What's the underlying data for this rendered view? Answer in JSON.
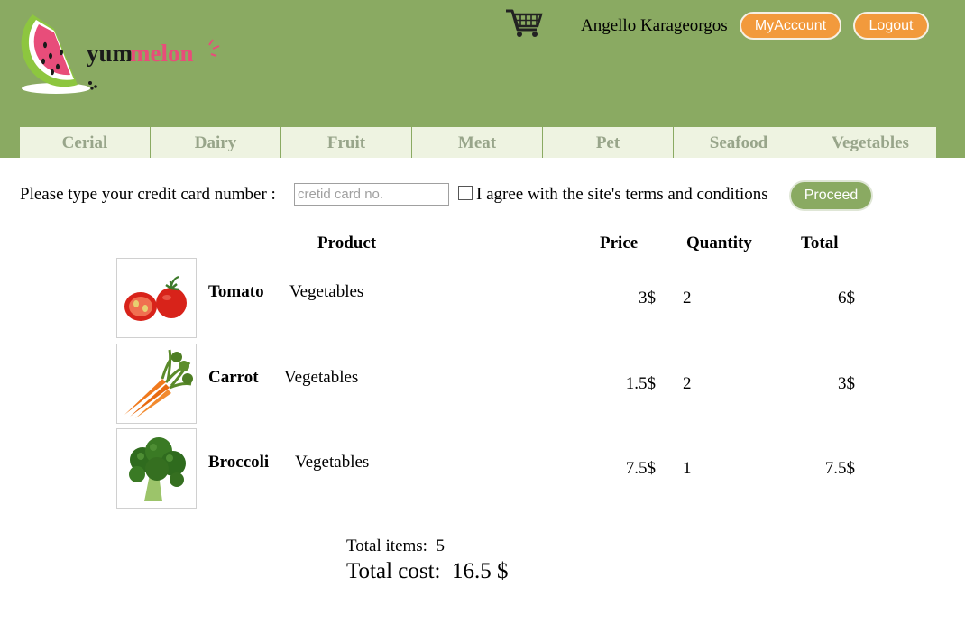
{
  "header": {
    "logo_text_part1": "yum",
    "logo_text_part2": "melon",
    "username": "Angello Karageorgos",
    "myaccount_label": "MyAccount",
    "logout_label": "Logout"
  },
  "categories": [
    "Cerial",
    "Dairy",
    "Fruit",
    "Meat",
    "Pet",
    "Seafood",
    "Vegetables"
  ],
  "payment": {
    "label": "Please type your credit card number :",
    "input_placeholder": "cretid card no.",
    "input_value": "",
    "terms_checked": false,
    "terms_label": "I agree with the site's terms and conditions",
    "proceed_label": "Proceed"
  },
  "table": {
    "headers": {
      "product": "Product",
      "price": "Price",
      "quantity": "Quantity",
      "total": "Total"
    },
    "rows": [
      {
        "name": "Tomato",
        "category": "Vegetables",
        "price": "3$",
        "quantity": "2",
        "total": "6$",
        "image": "tomato-image"
      },
      {
        "name": "Carrot",
        "category": "Vegetables",
        "price": "1.5$",
        "quantity": "2",
        "total": "3$",
        "image": "carrot-image"
      },
      {
        "name": "Broccoli",
        "category": "Vegetables",
        "price": "7.5$",
        "quantity": "1",
        "total": "7.5$",
        "image": "broccoli-image"
      }
    ]
  },
  "summary": {
    "items_label": "Total items:",
    "items_value": "5",
    "cost_label": "Total cost:",
    "cost_value": "16.5 $"
  },
  "colors": {
    "header_bg": "#8aaa62",
    "nav_bg": "#eef3e1",
    "nav_text": "#98a58a",
    "accent_orange": "#f29a3c",
    "logo_pink": "#e84d7a",
    "proceed_bg": "#8aaa62"
  },
  "icons": [
    "watermelon-logo-icon",
    "shopping-cart-icon"
  ]
}
